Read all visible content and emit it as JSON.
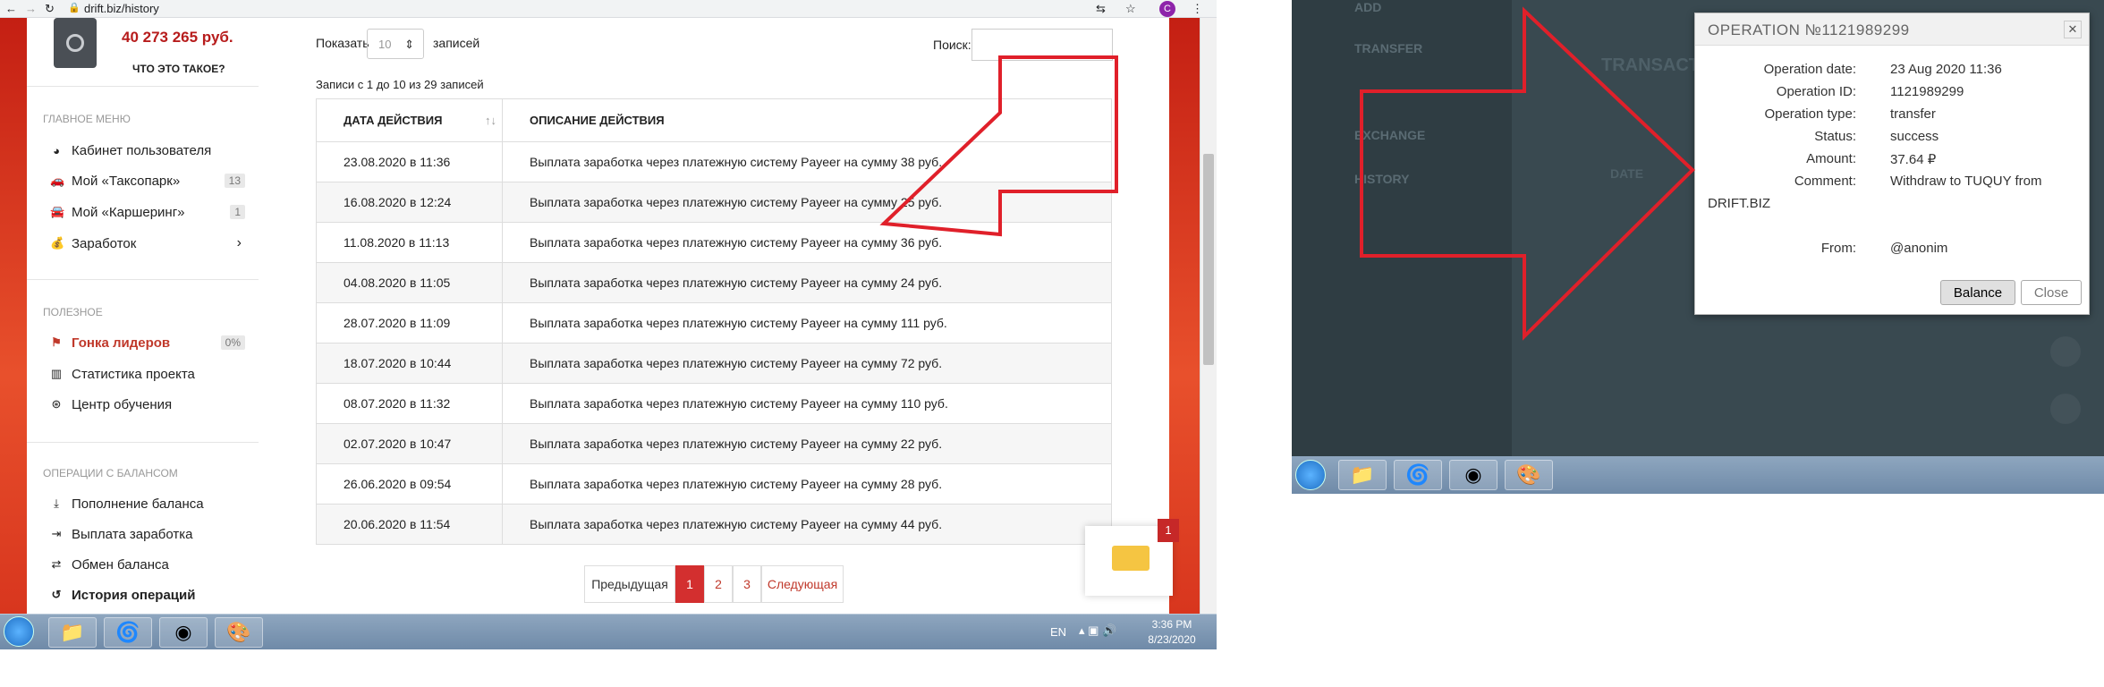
{
  "browser": {
    "url": "drift.biz/history"
  },
  "user": {
    "balance": "40 273 265 руб.",
    "what_link": "ЧТО ЭТО ТАКОЕ?",
    "avatar_letter": "C"
  },
  "menu": {
    "main_title": "ГЛАВНОЕ МЕНЮ",
    "main_items": [
      {
        "label": "Кабинет пользователя",
        "badge": ""
      },
      {
        "label": "Мой «Таксопарк»",
        "badge": "13"
      },
      {
        "label": "Мой «Каршеринг»",
        "badge": "1"
      },
      {
        "label": "Заработок",
        "badge": "›"
      }
    ],
    "useful_title": "ПОЛЕЗНОЕ",
    "useful_items": [
      {
        "label": "Гонка лидеров",
        "badge": "0%"
      },
      {
        "label": "Статистика проекта",
        "badge": ""
      },
      {
        "label": "Центр обучения",
        "badge": ""
      }
    ],
    "ops_title": "ОПЕРАЦИИ С БАЛАНСОМ",
    "ops_items": [
      {
        "label": "Пополнение баланса"
      },
      {
        "label": "Выплата заработка"
      },
      {
        "label": "Обмен баланса"
      },
      {
        "label": "История операций"
      }
    ]
  },
  "table": {
    "show_label": "Показать",
    "show_value": "10",
    "records_label": "записей",
    "search_label": "Поиск:",
    "info": "Записи с 1 до 10 из 29 записей",
    "columns": [
      "ДАТА ДЕЙСТВИЯ",
      "ОПИСАНИЕ ДЕЙСТВИЯ"
    ],
    "rows": [
      [
        "23.08.2020 в 11:36",
        "Выплата заработка через платежную систему Payeer на сумму 38 руб."
      ],
      [
        "16.08.2020 в 12:24",
        "Выплата заработка через платежную систему Payeer на сумму 25 руб."
      ],
      [
        "11.08.2020 в 11:13",
        "Выплата заработка через платежную систему Payeer на сумму 36 руб."
      ],
      [
        "04.08.2020 в 11:05",
        "Выплата заработка через платежную систему Payeer на сумму 24 руб."
      ],
      [
        "28.07.2020 в 11:09",
        "Выплата заработка через платежную систему Payeer на сумму 111 руб."
      ],
      [
        "18.07.2020 в 10:44",
        "Выплата заработка через платежную систему Payeer на сумму 72 руб."
      ],
      [
        "08.07.2020 в 11:32",
        "Выплата заработка через платежную систему Payeer на сумму 110 руб."
      ],
      [
        "02.07.2020 в 10:47",
        "Выплата заработка через платежную систему Payeer на сумму 22 руб."
      ],
      [
        "26.06.2020 в 09:54",
        "Выплата заработка через платежную систему Payeer на сумму 28 руб."
      ],
      [
        "20.06.2020 в 11:54",
        "Выплата заработка через платежную систему Payeer на сумму 44 руб."
      ]
    ]
  },
  "pagination": {
    "prev": "Предыдущая",
    "pages": [
      "1",
      "2",
      "3"
    ],
    "next": "Следующая"
  },
  "chat": {
    "badge": "1"
  },
  "tray": {
    "lang": "EN",
    "time": "3:36 PM",
    "date": "8/23/2020"
  },
  "modal": {
    "title": "OPERATION №1121989299",
    "fields": [
      {
        "label": "Operation date:",
        "value": "23 Aug 2020 11:36"
      },
      {
        "label": "Operation ID:",
        "value": "1121989299"
      },
      {
        "label": "Operation type:",
        "value": "transfer"
      },
      {
        "label": "Status:",
        "value": "success"
      },
      {
        "label": "Amount:",
        "value": "37.64 ₽"
      }
    ],
    "comment_label": "Comment:",
    "comment_value": "Withdraw to TUQUY from",
    "comment_cont": "DRIFT.BIZ",
    "from_label": "From:",
    "from_value": "@anonim",
    "balance_btn": "Balance",
    "close_btn": "Close"
  },
  "bg": {
    "add": "ADD",
    "transfer": "TRANSFER",
    "exchange": "EXCHANGE",
    "history": "HISTORY",
    "transactions": "TRANSACTI",
    "date": "DATE"
  },
  "colors": {
    "accent": "#c0392b",
    "arrow": "#e0202a"
  }
}
